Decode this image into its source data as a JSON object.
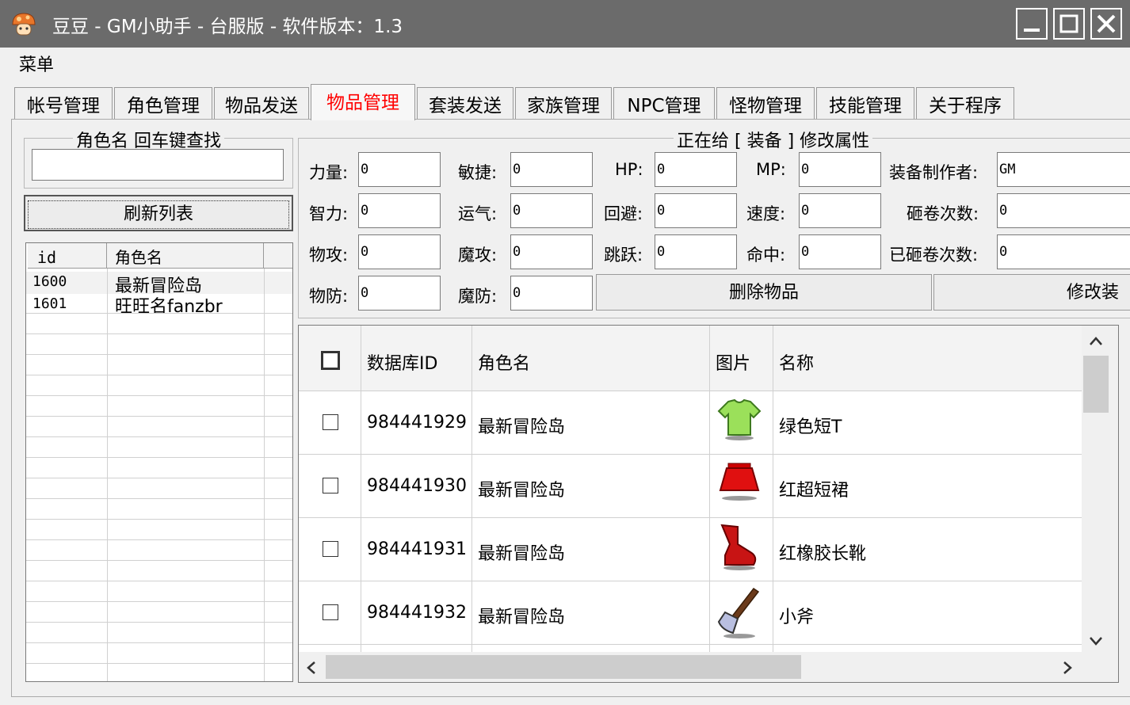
{
  "window": {
    "title": "豆豆 - GM小助手 - 台服版 - 软件版本：1.3"
  },
  "menu": {
    "label": "菜单"
  },
  "tabs": [
    "帐号管理",
    "角色管理",
    "物品发送",
    "物品管理",
    "套装发送",
    "家族管理",
    "NPC管理",
    "怪物管理",
    "技能管理",
    "关于程序"
  ],
  "left": {
    "search_title": "角色名 回车键查找",
    "search_value": "",
    "refresh_label": "刷新列表",
    "columns": [
      "id",
      "角色名"
    ],
    "rows": [
      {
        "id": "1600",
        "name": "最新冒险岛"
      },
      {
        "id": "1601",
        "name": "旺旺名fanzbr"
      }
    ]
  },
  "props": {
    "title": "正在给 [ 装备 ] 修改属性",
    "fields": {
      "str": {
        "label": "力量:",
        "value": "0"
      },
      "dex": {
        "label": "敏捷:",
        "value": "0"
      },
      "hp": {
        "label": "HP:",
        "value": "0"
      },
      "mp": {
        "label": "MP:",
        "value": "0"
      },
      "maker": {
        "label": "装备制作者:",
        "value": "GM"
      },
      "int": {
        "label": "智力:",
        "value": "0"
      },
      "luk": {
        "label": "运气:",
        "value": "0"
      },
      "avoid": {
        "label": "回避:",
        "value": "0"
      },
      "speed": {
        "label": "速度:",
        "value": "0"
      },
      "upgrades": {
        "label": "砸卷次数:",
        "value": "0"
      },
      "watk": {
        "label": "物攻:",
        "value": "0"
      },
      "matk": {
        "label": "魔攻:",
        "value": "0"
      },
      "jump": {
        "label": "跳跃:",
        "value": "0"
      },
      "acc": {
        "label": "命中:",
        "value": "0"
      },
      "used": {
        "label": "已砸卷次数:",
        "value": "0"
      },
      "wdef": {
        "label": "物防:",
        "value": "0"
      },
      "mdef": {
        "label": "魔防:",
        "value": "0"
      }
    },
    "delete_label": "删除物品",
    "modify_label": "修改装"
  },
  "items": {
    "columns": [
      "数据库ID",
      "角色名",
      "图片",
      "名称"
    ],
    "rows": [
      {
        "db_id": "984441929",
        "char": "最新冒险岛",
        "icon": "green-shirt-icon",
        "name": "绿色短T"
      },
      {
        "db_id": "984441930",
        "char": "最新冒险岛",
        "icon": "red-skirt-icon",
        "name": "红超短裙"
      },
      {
        "db_id": "984441931",
        "char": "最新冒险岛",
        "icon": "red-boots-icon",
        "name": "红橡胶长靴"
      },
      {
        "db_id": "984441932",
        "char": "最新冒险岛",
        "icon": "axe-icon",
        "name": "小斧"
      }
    ]
  }
}
